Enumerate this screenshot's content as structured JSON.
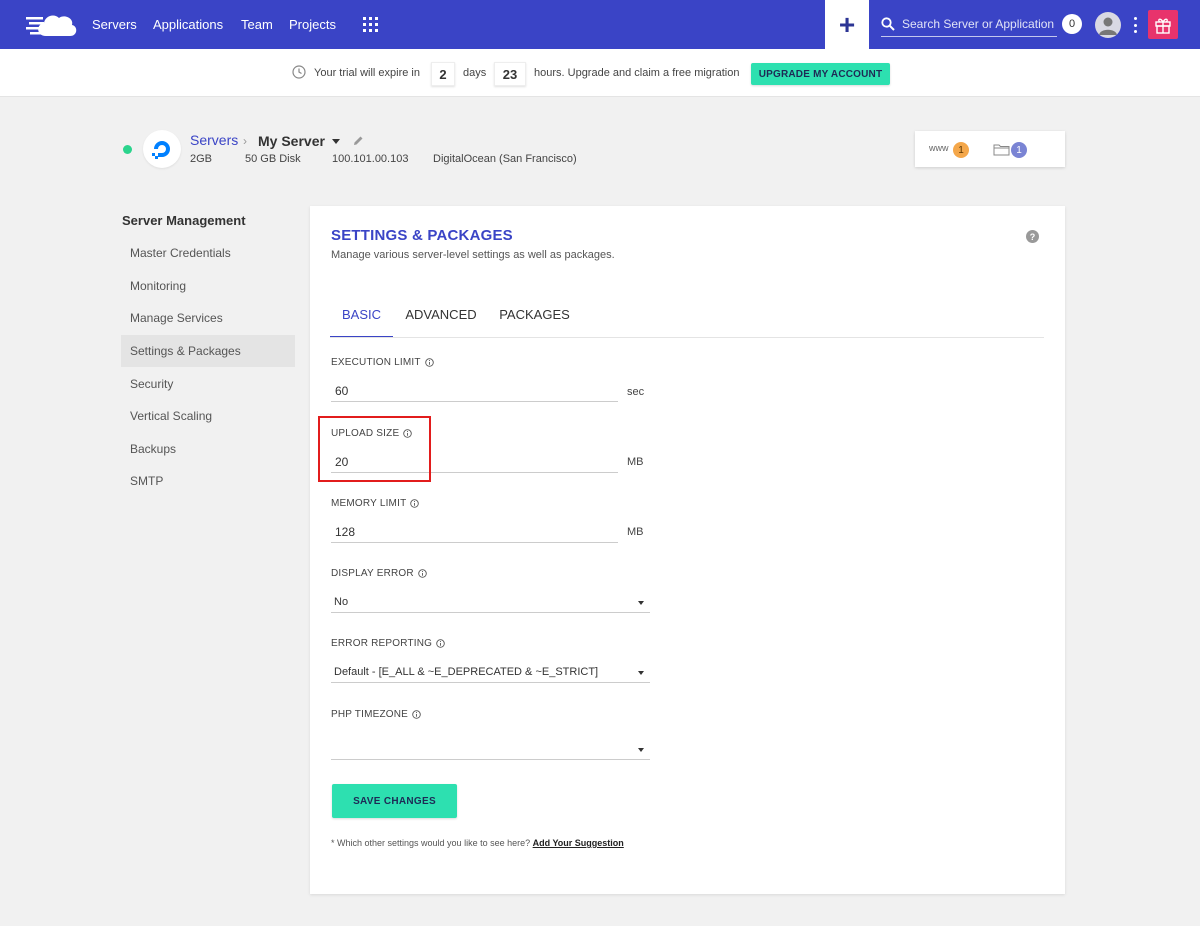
{
  "topnav": {
    "links": [
      "Servers",
      "Applications",
      "Team",
      "Projects"
    ],
    "search_placeholder": "Search Server or Application",
    "notification_count": "0",
    "colors": {
      "bar": "#3a44c6",
      "gift": "#e8336c"
    }
  },
  "trial": {
    "prefix": "Your trial will expire in",
    "days_value": "2",
    "days_label": "days",
    "hours_value": "23",
    "hours_suffix": "hours. Upgrade and claim a free migration",
    "upgrade_label": "UPGRADE MY ACCOUNT"
  },
  "server": {
    "breadcrumb_root": "Servers",
    "name": "My Server",
    "ram": "2GB",
    "disk": "50 GB Disk",
    "ip": "100.101.00.103",
    "provider": "DigitalOcean (San Francisco)",
    "www_label": "www",
    "apps_count": "1",
    "files_count": "1"
  },
  "sidebar": {
    "title": "Server Management",
    "items": [
      {
        "label": "Master Credentials",
        "active": false
      },
      {
        "label": "Monitoring",
        "active": false
      },
      {
        "label": "Manage Services",
        "active": false
      },
      {
        "label": "Settings & Packages",
        "active": true
      },
      {
        "label": "Security",
        "active": false
      },
      {
        "label": "Vertical Scaling",
        "active": false
      },
      {
        "label": "Backups",
        "active": false
      },
      {
        "label": "SMTP",
        "active": false
      }
    ]
  },
  "main": {
    "title": "SETTINGS & PACKAGES",
    "subtitle": "Manage various server-level settings as well as packages.",
    "tabs": [
      {
        "label": "BASIC",
        "active": true
      },
      {
        "label": "ADVANCED",
        "active": false
      },
      {
        "label": "PACKAGES",
        "active": false
      }
    ],
    "fields": {
      "execution_limit": {
        "label": "EXECUTION LIMIT",
        "value": "60",
        "unit": "sec"
      },
      "upload_size": {
        "label": "UPLOAD SIZE",
        "value": "20",
        "unit": "MB"
      },
      "memory_limit": {
        "label": "MEMORY LIMIT",
        "value": "128",
        "unit": "MB"
      },
      "display_error": {
        "label": "DISPLAY ERROR",
        "value": "No"
      },
      "error_reporting": {
        "label": "ERROR REPORTING",
        "value": "Default - [E_ALL & ~E_DEPRECATED & ~E_STRICT]"
      },
      "php_timezone": {
        "label": "PHP TIMEZONE",
        "value": ""
      }
    },
    "save_label": "SAVE CHANGES",
    "footnote_text": "* Which other settings would you like to see here?",
    "footnote_link": "Add Your Suggestion"
  },
  "accent_colors": {
    "primary": "#3a44c6",
    "cta": "#2de0b0",
    "status_online": "#2bd48d",
    "highlight": "#e21c1c"
  }
}
